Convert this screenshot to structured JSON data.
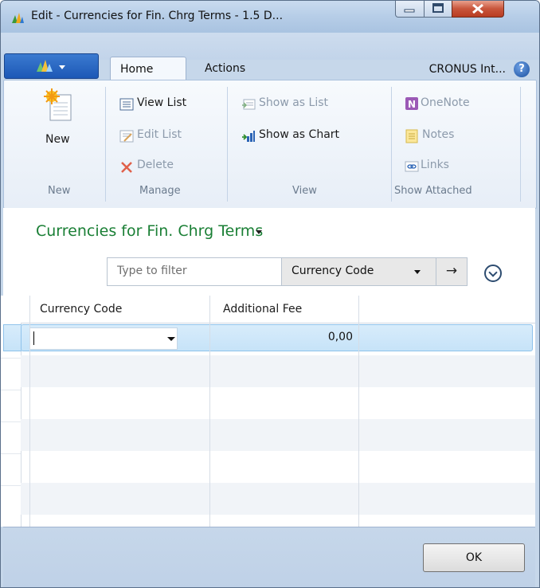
{
  "window": {
    "title": "Edit - Currencies for Fin. Chrg Terms - 1.5 D..."
  },
  "ribbon": {
    "tabs": [
      {
        "label": "Home"
      },
      {
        "label": "Actions"
      }
    ],
    "company": "CRONUS Int...",
    "groups": {
      "new": {
        "label": "New",
        "items": [
          {
            "label": "New"
          }
        ]
      },
      "manage": {
        "label": "Manage",
        "items": [
          {
            "label": "View List"
          },
          {
            "label": "Edit List"
          },
          {
            "label": "Delete"
          }
        ]
      },
      "view": {
        "label": "View",
        "items": [
          {
            "label": "Show as List"
          },
          {
            "label": "Show as Chart"
          }
        ]
      },
      "attached": {
        "label": "Show Attached",
        "items": [
          {
            "label": "OneNote"
          },
          {
            "label": "Notes"
          },
          {
            "label": "Links"
          }
        ]
      }
    }
  },
  "page": {
    "title": "Currencies for Fin. Chrg Terms"
  },
  "filter": {
    "placeholder": "Type to filter",
    "field": "Currency Code",
    "go_glyph": "→"
  },
  "grid": {
    "columns": [
      "Currency Code",
      "Additional Fee"
    ],
    "rows": [
      {
        "currency_code": "",
        "additional_fee": "0,00"
      }
    ]
  },
  "footer": {
    "ok_label": "OK"
  },
  "colors": {
    "page_title": "#1a7f35",
    "selection": "#c6e3f8",
    "close_button": "#c8553b"
  }
}
